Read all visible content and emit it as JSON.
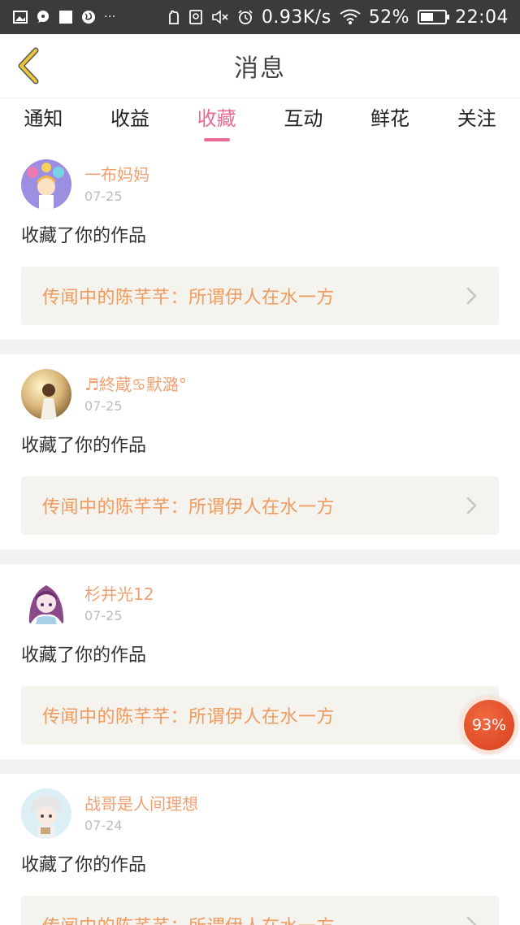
{
  "status_bar": {
    "speed": "0.93K/s",
    "battery_percent": "52%",
    "battery_level": 0.52,
    "time": "22:04",
    "left_icons": [
      "image-icon",
      "chat-icon",
      "square-icon",
      "globe-icon",
      "more-dots-icon"
    ],
    "right_icons": [
      "hand-icon",
      "sim-icon",
      "mute-icon",
      "alarm-icon",
      "wifi-icon",
      "battery-icon"
    ],
    "more": "···"
  },
  "header": {
    "title": "消息",
    "back_icon": "chevron-left-icon",
    "accent": "#e8c637"
  },
  "tabs": [
    {
      "label": "通知",
      "active": false
    },
    {
      "label": "收益",
      "active": false
    },
    {
      "label": "收藏",
      "active": true
    },
    {
      "label": "互动",
      "active": false
    },
    {
      "label": "鲜花",
      "active": false
    },
    {
      "label": "关注",
      "active": false
    }
  ],
  "colors": {
    "active_tab": "#e96a93",
    "username": "#f0a070",
    "work_title": "#f09a5e",
    "work_box_bg": "#f5f3ee"
  },
  "feed": [
    {
      "username": "一布妈妈",
      "date": "07-25",
      "action": "收藏了你的作品",
      "work_title": "传闻中的陈芊芊：所谓伊人在水一方"
    },
    {
      "username": "♬終蔵♋默潞°",
      "date": "07-25",
      "action": "收藏了你的作品",
      "work_title": "传闻中的陈芊芊：所谓伊人在水一方"
    },
    {
      "username": "杉井光12",
      "date": "07-25",
      "action": "收藏了你的作品",
      "work_title": "传闻中的陈芊芊：所谓伊人在水一方"
    },
    {
      "username": "战哥是人间理想",
      "date": "07-24",
      "action": "收藏了你的作品",
      "work_title": "传闻中的陈芊芊：所谓伊人在水一方"
    }
  ],
  "float_badge": {
    "text": "93%"
  }
}
